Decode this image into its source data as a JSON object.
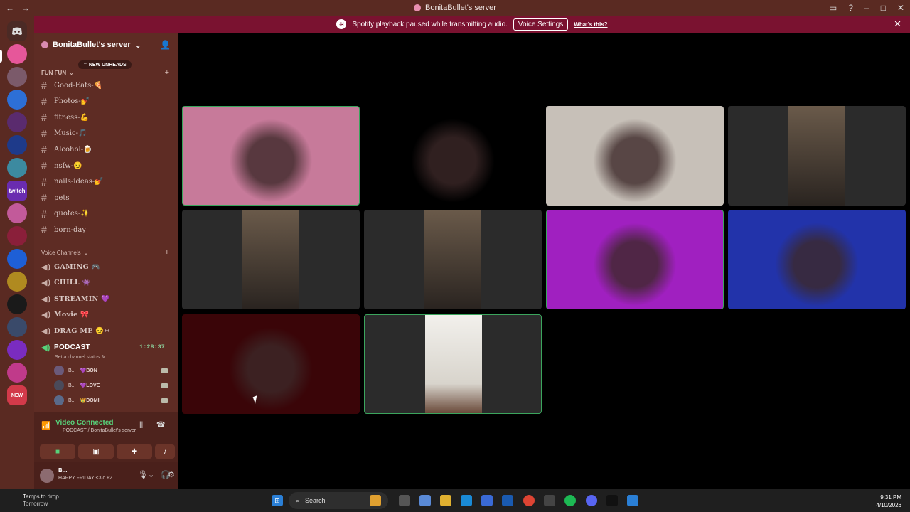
{
  "window": {
    "title": "BonitaBullet's server",
    "nav": {
      "back": "←",
      "forward": "→"
    },
    "controls": {
      "inbox": "▭",
      "help": "?",
      "minimize": "–",
      "maximize": "□",
      "close": "✕"
    }
  },
  "banner": {
    "message": "Spotify playback paused while transmitting audio.",
    "button": "Voice Settings",
    "link": "What's this?",
    "close": "✕"
  },
  "server": {
    "name": "BonitaBullet's server",
    "chevron": "⌄"
  },
  "sidebar": {
    "new_unreads": "NEW UNREADS",
    "category_text": "FUN FUN",
    "text_channels": [
      {
        "name": "Good-Eats-🍕"
      },
      {
        "name": "Photos-💅"
      },
      {
        "name": "fitness-💪"
      },
      {
        "name": "Music-🎵"
      },
      {
        "name": "Alcohol-🍺"
      },
      {
        "name": "nsfw-😏"
      },
      {
        "name": "nails-ideas-💅"
      },
      {
        "name": "pets"
      },
      {
        "name": "quotes-✨"
      },
      {
        "name": "born-day"
      }
    ],
    "category_voice": "Voice Channels",
    "voice_channels": [
      {
        "name": "GAMING 🎮"
      },
      {
        "name": "CHILL 👾"
      },
      {
        "name": "STREAMIN 💜"
      },
      {
        "name": "Movie 🎀"
      },
      {
        "name": "DRAG ME 😏↔"
      }
    ],
    "active_voice": {
      "name": "PODCAST",
      "timer": "1:28:37",
      "status": "Set a channel status"
    },
    "members": [
      {
        "prefix": "B...",
        "tag": "💜BON"
      },
      {
        "prefix": "B...",
        "tag": "💜LOVE"
      },
      {
        "prefix": "B...",
        "tag": "👑DOMI"
      }
    ]
  },
  "voice_panel": {
    "status": "Video Connected",
    "location": "PODCAST / BonitaBullet's server",
    "buttons": [
      "camera",
      "screen-share",
      "activities",
      "soundboard"
    ]
  },
  "user": {
    "name": "B...",
    "status": "HAPPY FRIDAY <3 c +2"
  },
  "server_rail": {
    "new_badge": "NEW",
    "twitch_label": "twitch"
  },
  "colors": {
    "sidebar": "#5e2c24",
    "rail": "#5a2a22",
    "banner": "#7a1230",
    "speaking": "#3ba55d",
    "connected": "#57d27a"
  },
  "video_tiles": [
    {
      "speaking": true,
      "bg": "#c77a9a",
      "feed": "pink room"
    },
    {
      "speaking": false,
      "bg": "#000000",
      "feed": "dark room"
    },
    {
      "speaking": false,
      "bg": "#c7c0b8",
      "feed": "room with shelves"
    },
    {
      "speaking": false,
      "bg": "#2b2b2b",
      "feed": "portrait"
    },
    {
      "speaking": false,
      "bg": "#2b2b2b",
      "feed": "portrait"
    },
    {
      "speaking": false,
      "bg": "#2b2b2b",
      "feed": "portrait"
    },
    {
      "speaking": true,
      "bg": "#a020c0",
      "feed": "purple room"
    },
    {
      "speaking": false,
      "bg": "#2233aa",
      "feed": "blue room"
    },
    {
      "speaking": false,
      "bg": "#3a0508",
      "feed": "red room"
    },
    {
      "speaking": true,
      "bg": "#2b2b2b",
      "feed": "portrait"
    }
  ],
  "taskbar": {
    "weather_title": "Temps to drop",
    "weather_sub": "Tomorrow",
    "search": "Search",
    "time": "9:31 PM",
    "date": "4/10/2026"
  }
}
